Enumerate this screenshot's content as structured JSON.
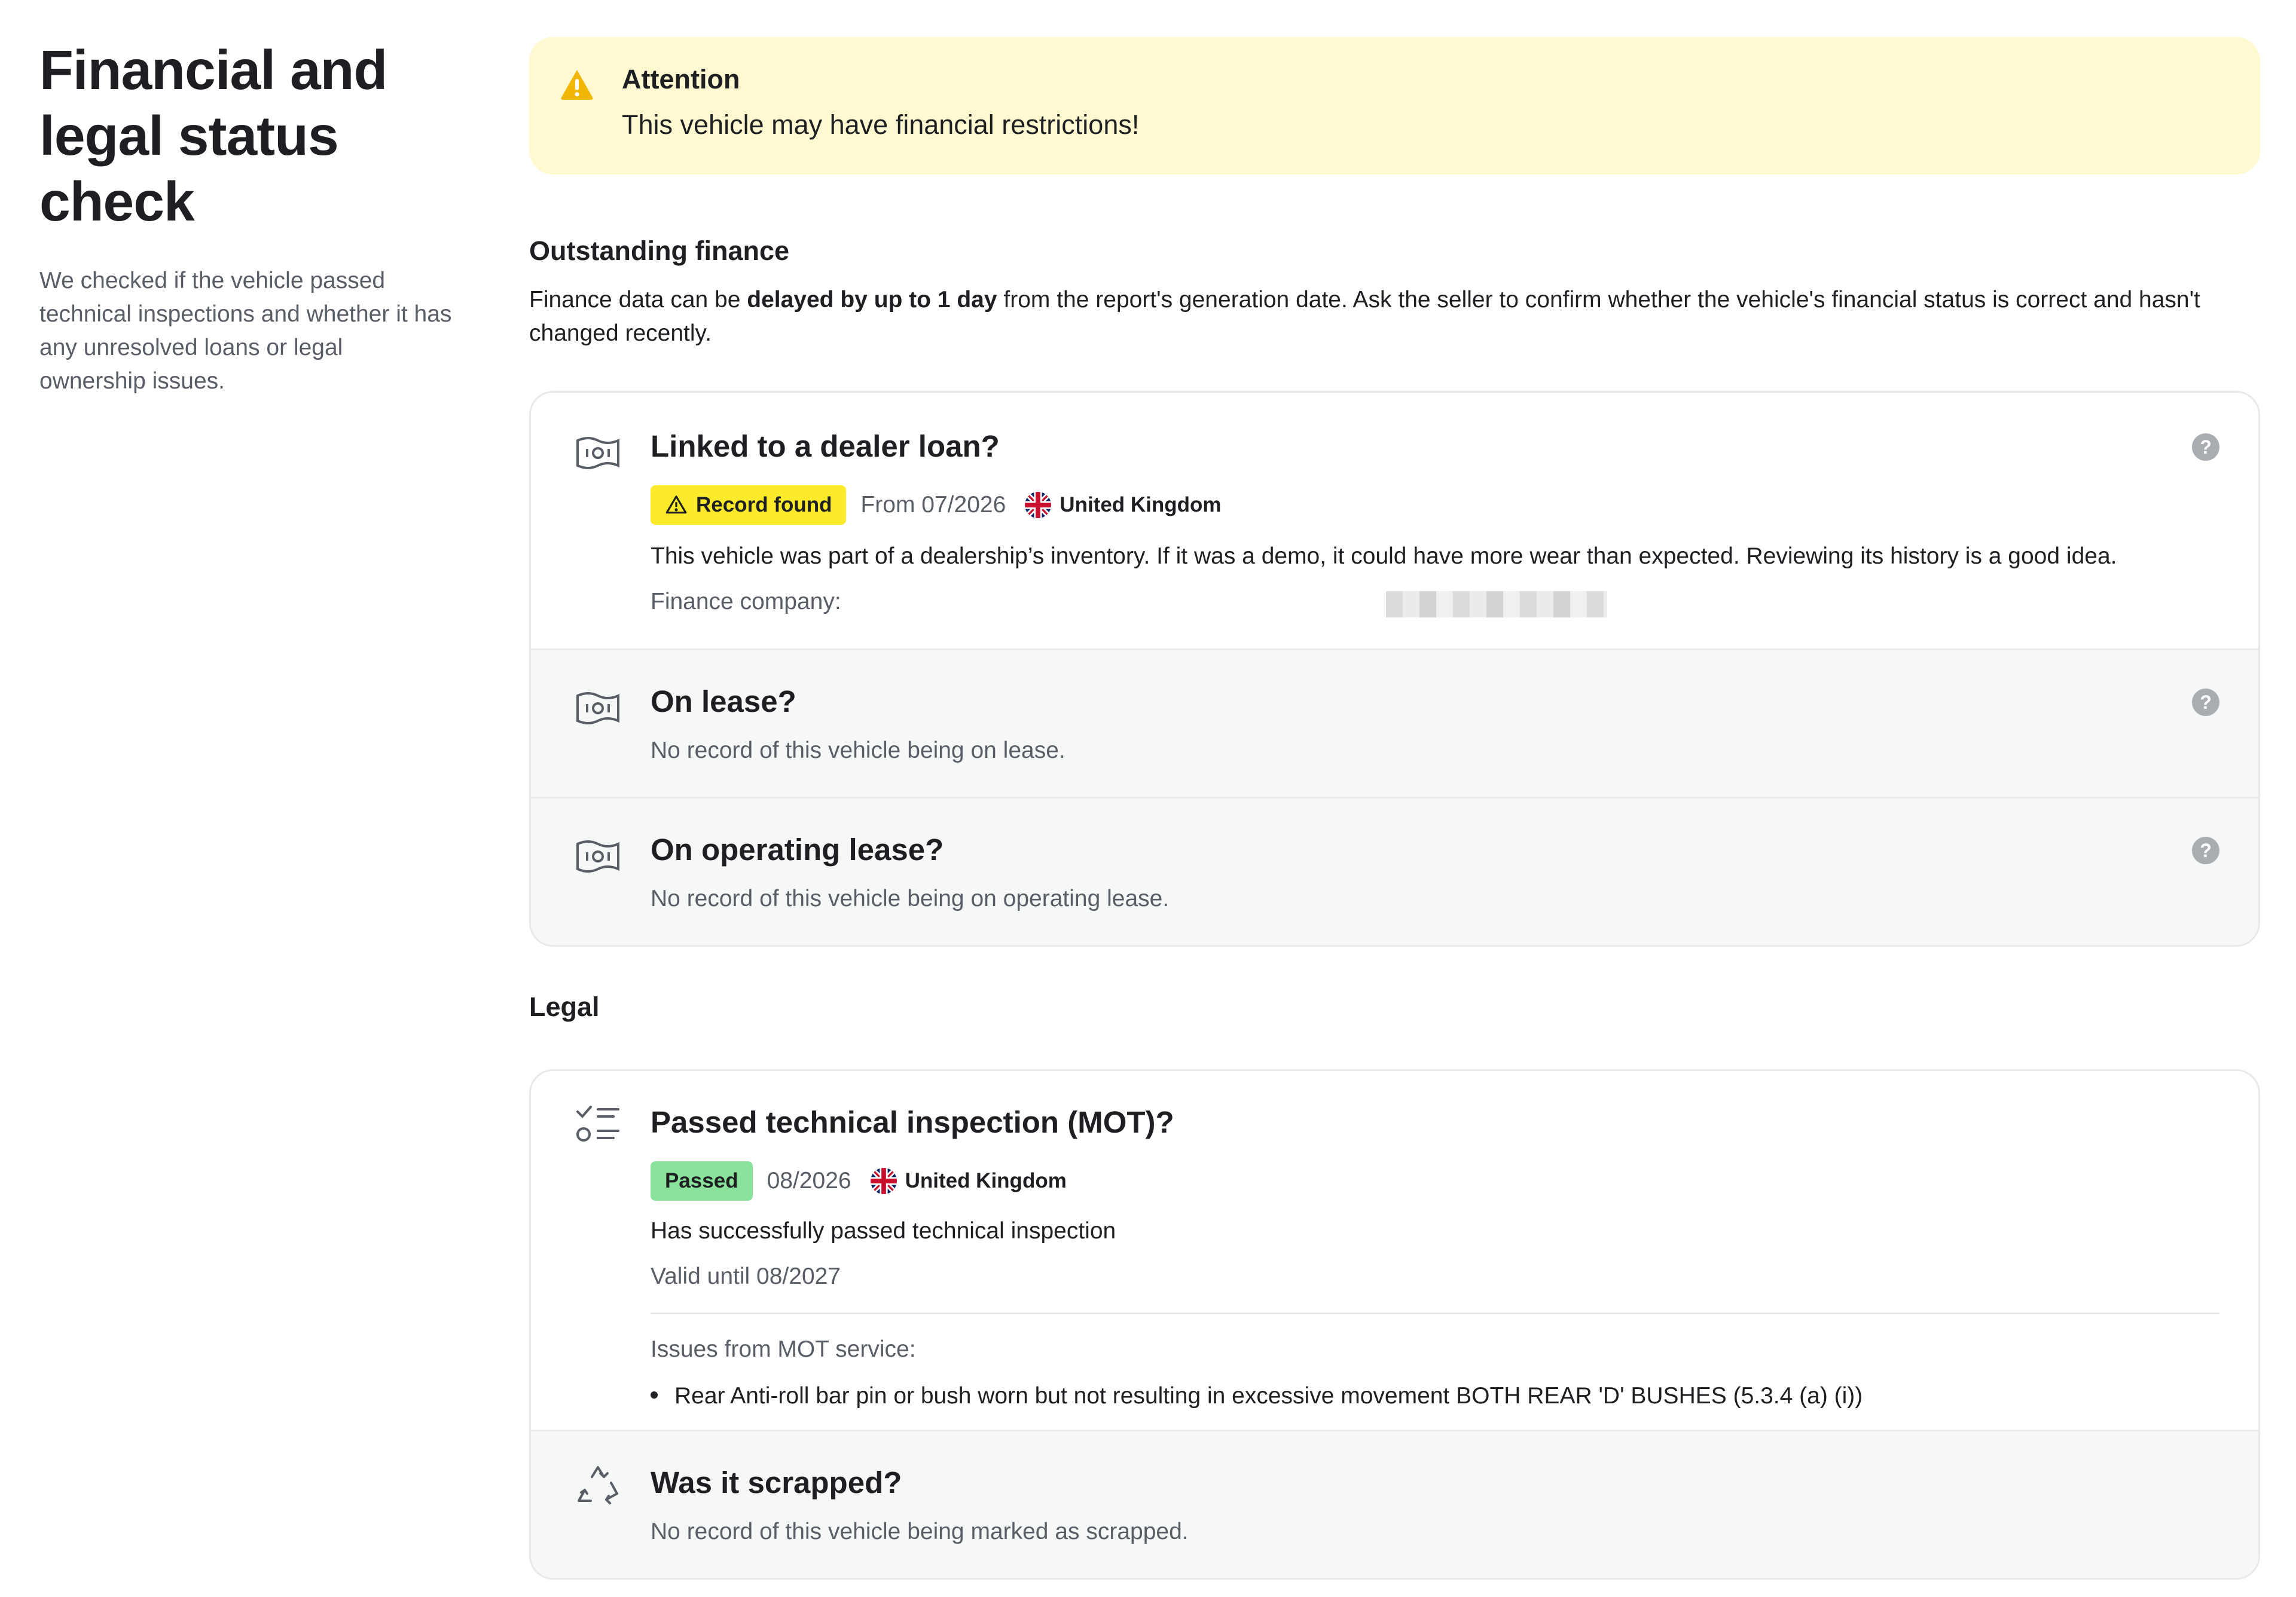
{
  "sidebar": {
    "title": "Financial and legal status check",
    "description": "We checked if the vehicle passed technical inspections and whether it has any unresolved loans or legal ownership issues."
  },
  "alert": {
    "title": "Attention",
    "message": "This vehicle may have financial restrictions!"
  },
  "finance": {
    "title": "Outstanding finance",
    "desc_before": "Finance data can be ",
    "desc_bold": "delayed by up to 1 day",
    "desc_after": " from the report's generation date. Ask the seller to confirm whether the vehicle's financial status is correct and hasn't changed recently.",
    "rows": [
      {
        "title": "Linked to a dealer loan?",
        "badge": "Record found",
        "date": "From 07/2026",
        "country": "United Kingdom",
        "text": "This vehicle was part of a dealership’s inventory. If it was a demo, it could have more wear than expected. Reviewing its history is a good idea.",
        "company_label": "Finance company:"
      },
      {
        "title": "On lease?",
        "text": "No record of this vehicle being on lease."
      },
      {
        "title": "On operating lease?",
        "text": "No record of this vehicle being on operating lease."
      }
    ]
  },
  "legal": {
    "title": "Legal",
    "rows": [
      {
        "title": "Passed technical inspection (MOT)?",
        "badge": "Passed",
        "date": "08/2026",
        "country": "United Kingdom",
        "text": "Has successfully passed technical inspection",
        "valid": "Valid until 08/2027",
        "issues_label": "Issues from MOT service:",
        "issues": [
          "Rear Anti-roll bar pin or bush worn but not resulting in excessive movement BOTH REAR 'D' BUSHES (5.3.4 (a) (i))"
        ]
      },
      {
        "title": "Was it scrapped?",
        "text": "No record of this vehicle being marked as scrapped."
      }
    ]
  },
  "help_glyph": "?",
  "colors": {
    "alert_bg": "#fff9d1",
    "warning_icon": "#f2b705",
    "badge_record_found": "#fdea2b",
    "badge_passed": "#8ae39b"
  }
}
